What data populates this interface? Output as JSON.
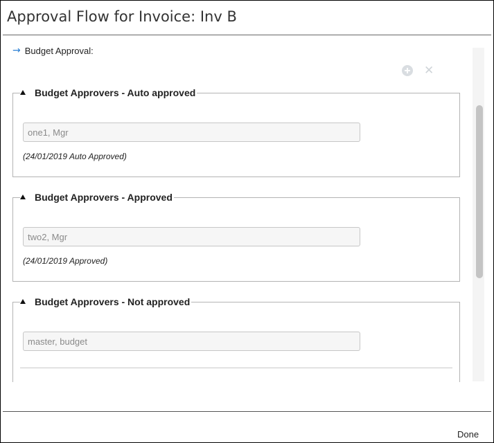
{
  "dialog": {
    "title": "Approval Flow for Invoice: Inv B",
    "done_label": "Done"
  },
  "section": {
    "icon": "arrow-right-icon",
    "heading": "Budget Approval:"
  },
  "toolbar": {
    "add_icon": "plus-circle-icon",
    "remove_icon": "close-x-icon"
  },
  "groups": [
    {
      "title": "Budget Approvers - Auto approved",
      "approver": "one1, Mgr",
      "note": "(24/01/2019 Auto Approved)"
    },
    {
      "title": "Budget Approvers - Approved",
      "approver": "two2, Mgr",
      "note": "(24/01/2019 Approved)"
    },
    {
      "title": "Budget Approvers - Not approved",
      "approver": "master, budget",
      "note": ""
    }
  ],
  "colors": {
    "arrow_accent": "#2a7fd4",
    "field_background": "#f6f6f6",
    "field_text": "#8a8a8a"
  }
}
